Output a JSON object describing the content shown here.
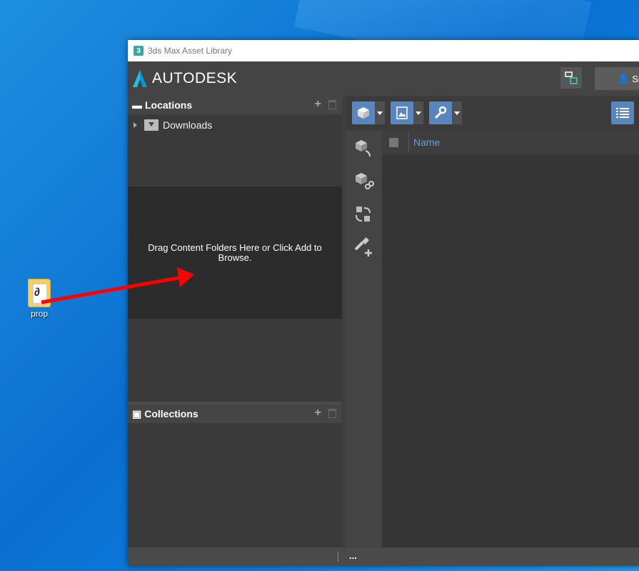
{
  "desktop": {
    "icon_label": "prop"
  },
  "window": {
    "title": "3ds Max Asset Library",
    "app_icon_text": "3",
    "brand": "AUTODESK",
    "sign_in_label": "Si"
  },
  "locations": {
    "header": "Locations",
    "items": [
      {
        "label": "Downloads"
      }
    ],
    "drop_hint": "Drag Content Folders Here or Click Add to Browse."
  },
  "collections": {
    "header": "Collections"
  },
  "grid": {
    "column_name": "Name"
  },
  "status": {
    "text": "..."
  },
  "colors": {
    "accent": "#5a86bd",
    "link": "#6a9be0",
    "arrow": "#ff0000"
  }
}
